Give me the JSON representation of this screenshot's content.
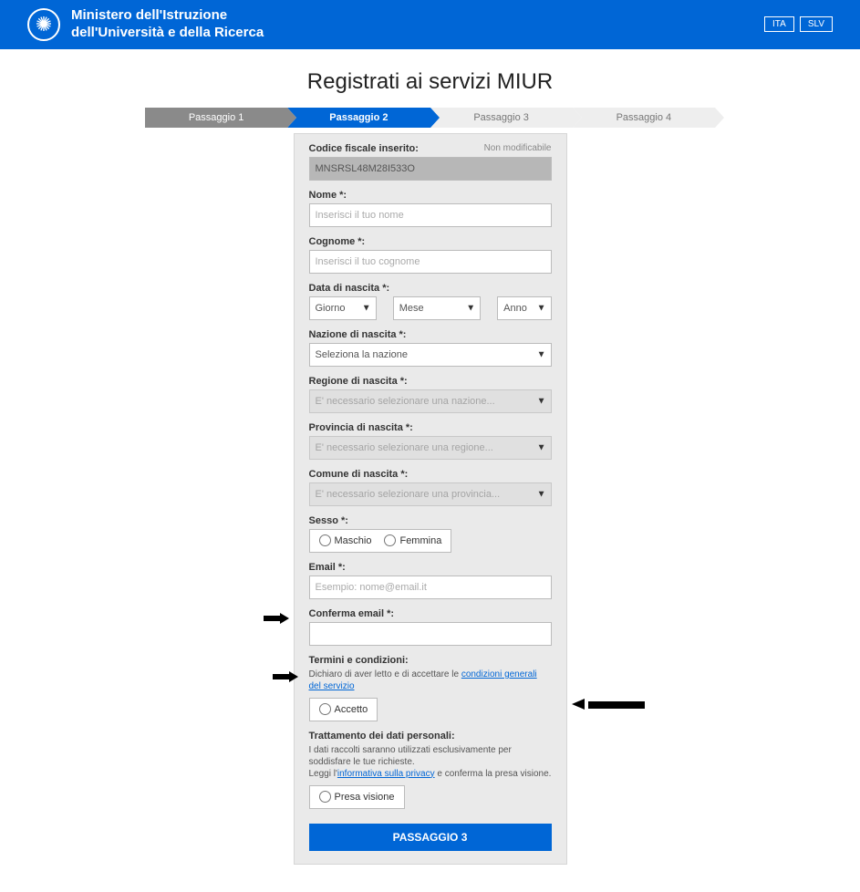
{
  "header": {
    "title_line1": "Ministero dell'Istruzione",
    "title_line2": "dell'Università e della Ricerca",
    "lang_ita": "ITA",
    "lang_slv": "SLV"
  },
  "page_title": "Registrati ai servizi MIUR",
  "stepper": {
    "step1": "Passaggio 1",
    "step2": "Passaggio 2",
    "step3": "Passaggio 3",
    "step4": "Passaggio 4"
  },
  "fields": {
    "cf_label": "Codice fiscale inserito:",
    "cf_note": "Non modificabile",
    "cf_value": "MNSRSL48M28I533O",
    "nome_label": "Nome *:",
    "nome_placeholder": "Inserisci il tuo nome",
    "cognome_label": "Cognome *:",
    "cognome_placeholder": "Inserisci il tuo cognome",
    "data_label": "Data di nascita *:",
    "giorno": "Giorno",
    "mese": "Mese",
    "anno": "Anno",
    "nazione_label": "Nazione di nascita *:",
    "nazione_placeholder": "Seleziona la nazione",
    "regione_label": "Regione di nascita *:",
    "regione_placeholder": "E' necessario selezionare una nazione...",
    "provincia_label": "Provincia di nascita *:",
    "provincia_placeholder": "E' necessario selezionare una regione...",
    "comune_label": "Comune di nascita *:",
    "comune_placeholder": "E' necessario selezionare una provincia...",
    "sesso_label": "Sesso *:",
    "maschio": "Maschio",
    "femmina": "Femmina",
    "email_label": "Email *:",
    "email_placeholder": "Esempio: nome@email.it",
    "conferma_email_label": "Conferma email *:",
    "termini_label": "Termini e condizioni:",
    "termini_text_prefix": "Dichiaro di aver letto e di accettare le ",
    "termini_link": "condizioni generali del servizio",
    "accetto": "Accetto",
    "privacy_label": "Trattamento dei dati personali:",
    "privacy_text1": "I dati raccolti saranno utilizzati esclusivamente per soddisfare le tue richieste.",
    "privacy_text2_prefix": "Leggi l'",
    "privacy_link": "informativa sulla privacy",
    "privacy_text2_suffix": " e conferma la presa visione.",
    "presa_visione": "Presa visione",
    "submit": "PASSAGGIO 3"
  }
}
